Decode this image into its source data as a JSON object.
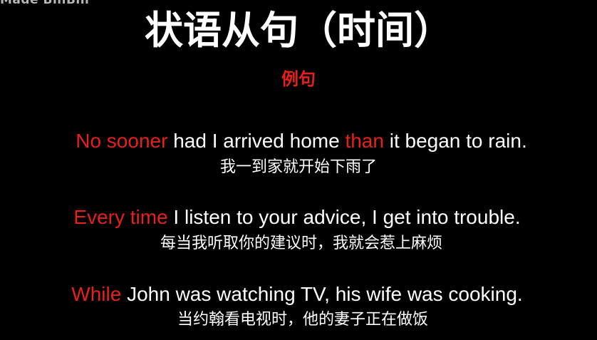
{
  "colors": {
    "background": "#000000",
    "text": "#ffffff",
    "accent": "#e8201a"
  },
  "watermark": "Made  BiliBili",
  "title": "状语从句（时间）",
  "subtitle": "例句",
  "examples": [
    {
      "en_segments": [
        {
          "text": "No sooner",
          "highlight": true
        },
        {
          "text": " had I arrived home ",
          "highlight": false
        },
        {
          "text": "than",
          "highlight": true
        },
        {
          "text": " it began to rain.",
          "highlight": false
        }
      ],
      "zh": "我一到家就开始下雨了"
    },
    {
      "en_segments": [
        {
          "text": "Every time",
          "highlight": true
        },
        {
          "text": " I listen to your advice, I get into trouble.",
          "highlight": false
        }
      ],
      "zh": "每当我听取你的建议时，我就会惹上麻烦"
    },
    {
      "en_segments": [
        {
          "text": "While",
          "highlight": true
        },
        {
          "text": " John was watching TV, his wife was cooking.",
          "highlight": false
        }
      ],
      "zh": "当约翰看电视时，他的妻子正在做饭"
    }
  ]
}
